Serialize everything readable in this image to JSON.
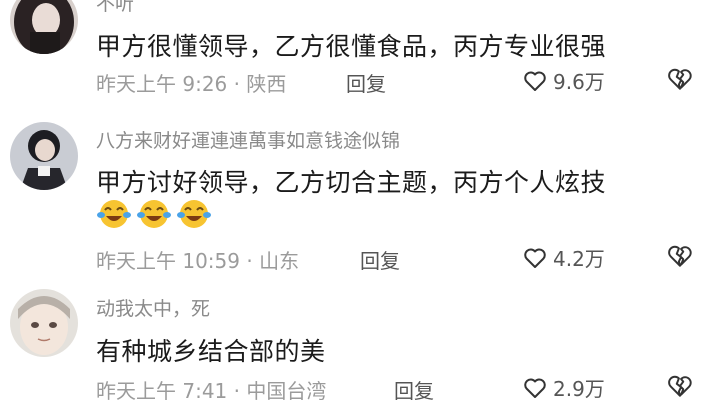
{
  "comments": [
    {
      "username": "不听",
      "content": "甲方很懂领导，乙方很懂食品，丙方专业很强",
      "time": "昨天上午 9:26 · 陕西",
      "reply_label": "回复",
      "likes": "9.6万"
    },
    {
      "username": "八方来财好運連連萬事如意钱途似锦",
      "content": "甲方讨好领导，乙方切合主题，丙方个人炫技",
      "emojis": [
        "crying-laughing-emoji",
        "crying-laughing-emoji",
        "crying-laughing-emoji"
      ],
      "time": "昨天上午 10:59 · 山东",
      "reply_label": "回复",
      "likes": "4.2万"
    },
    {
      "username": "动我太中，死",
      "content": "有种城乡结合部的美",
      "time": "昨天上午 7:41 · 中国台湾",
      "reply_label": "回复",
      "likes": "2.9万"
    }
  ],
  "colors": {
    "text_primary": "#1b1b1b",
    "text_secondary": "#8a8a8a",
    "emoji_yellow": "#f7c431"
  },
  "icons": {
    "like": "heart-outline-icon",
    "dislike": "broken-heart-icon"
  }
}
